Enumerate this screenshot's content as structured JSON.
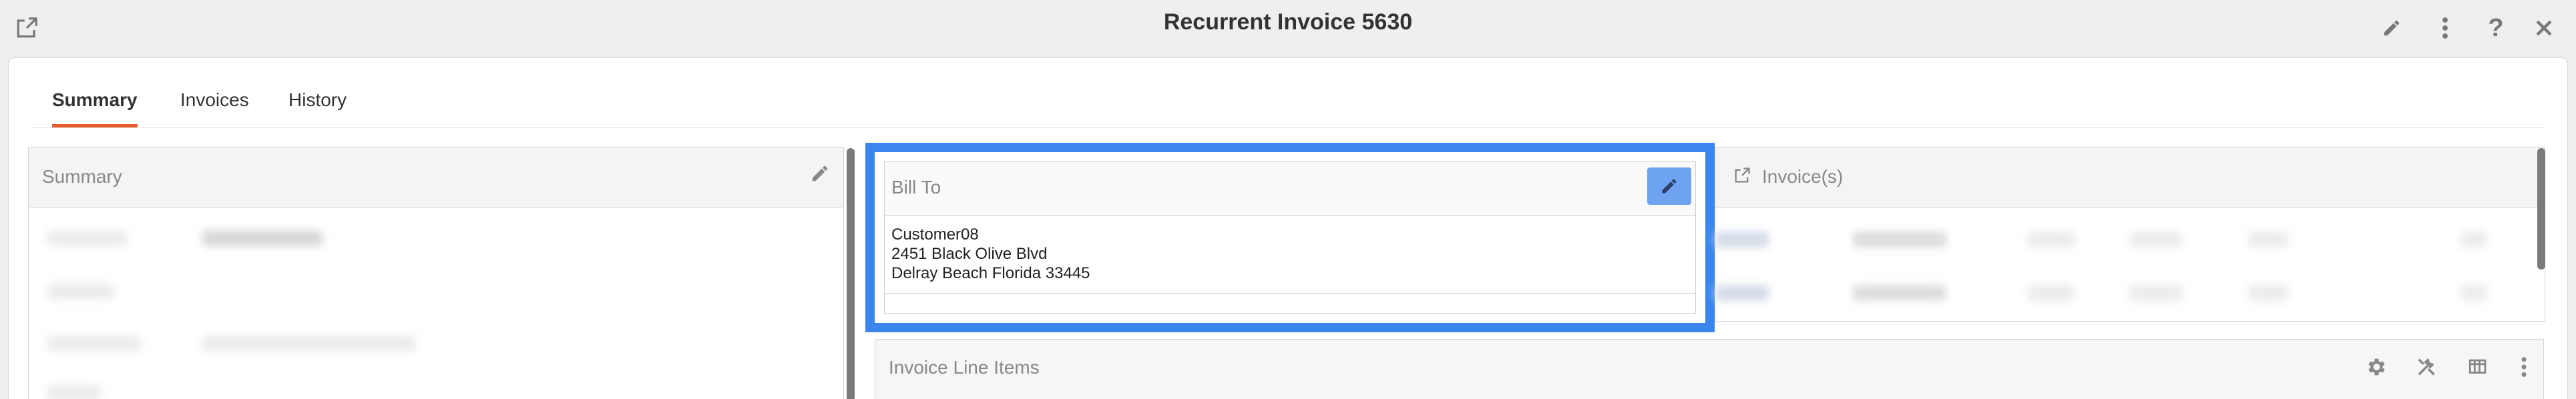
{
  "window": {
    "title": "Recurrent Invoice 5630"
  },
  "tabs": [
    {
      "label": "Summary"
    },
    {
      "label": "Invoices"
    },
    {
      "label": "History"
    }
  ],
  "summary_panel": {
    "title": "Summary"
  },
  "bill_to": {
    "title": "Bill To",
    "address_lines": [
      "Customer08",
      "2451 Black Olive Blvd",
      "Delray Beach Florida 33445"
    ]
  },
  "invoices_panel": {
    "title": "Invoice(s)"
  },
  "line_items_panel": {
    "title": "Invoice Line Items"
  },
  "colors": {
    "accent_tab": "#e45b2c",
    "highlight": "#3b86ee",
    "edit_button": "#6ea3f2"
  },
  "icons": [
    "open-external-icon",
    "pencil-icon",
    "more-vertical-icon",
    "help-icon",
    "close-icon",
    "gear-icon",
    "tools-icon",
    "columns-icon"
  ]
}
